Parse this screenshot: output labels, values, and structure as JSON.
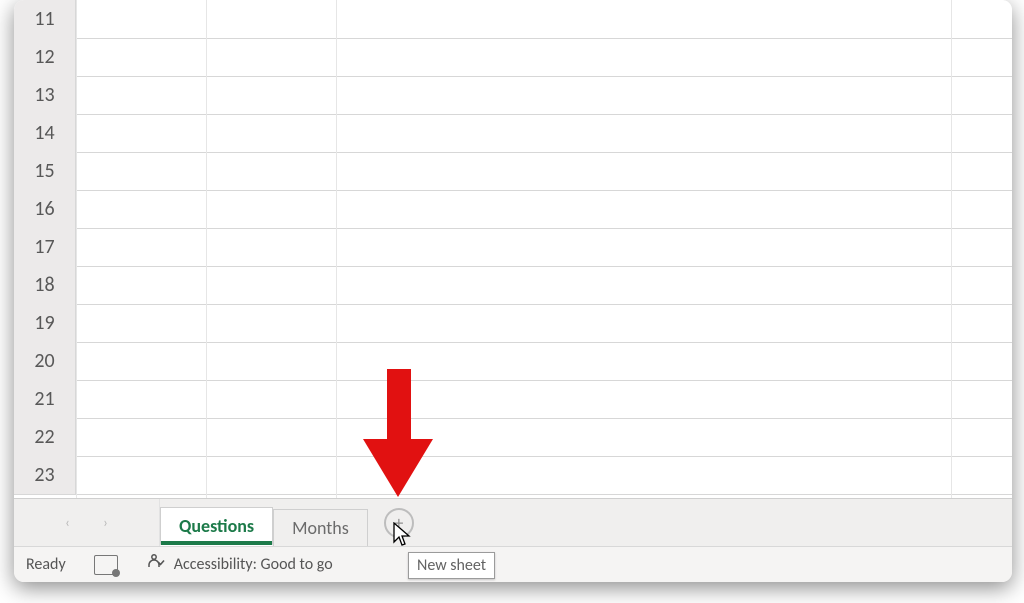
{
  "rows": [
    "11",
    "12",
    "13",
    "14",
    "15",
    "16",
    "17",
    "18",
    "19",
    "20",
    "21",
    "22",
    "23"
  ],
  "column_separators": [
    62,
    192,
    322,
    937
  ],
  "tabs": {
    "nav_prev": "‹",
    "nav_next": "›",
    "sheets": [
      {
        "label": "Questions",
        "active": true
      },
      {
        "label": "Months",
        "active": false
      }
    ],
    "new_sheet_label": "+"
  },
  "tooltip": {
    "text": "New sheet"
  },
  "status": {
    "ready": "Ready",
    "accessibility": "Accessibility: Good to go"
  },
  "annotation": {
    "color": "#e11111"
  }
}
